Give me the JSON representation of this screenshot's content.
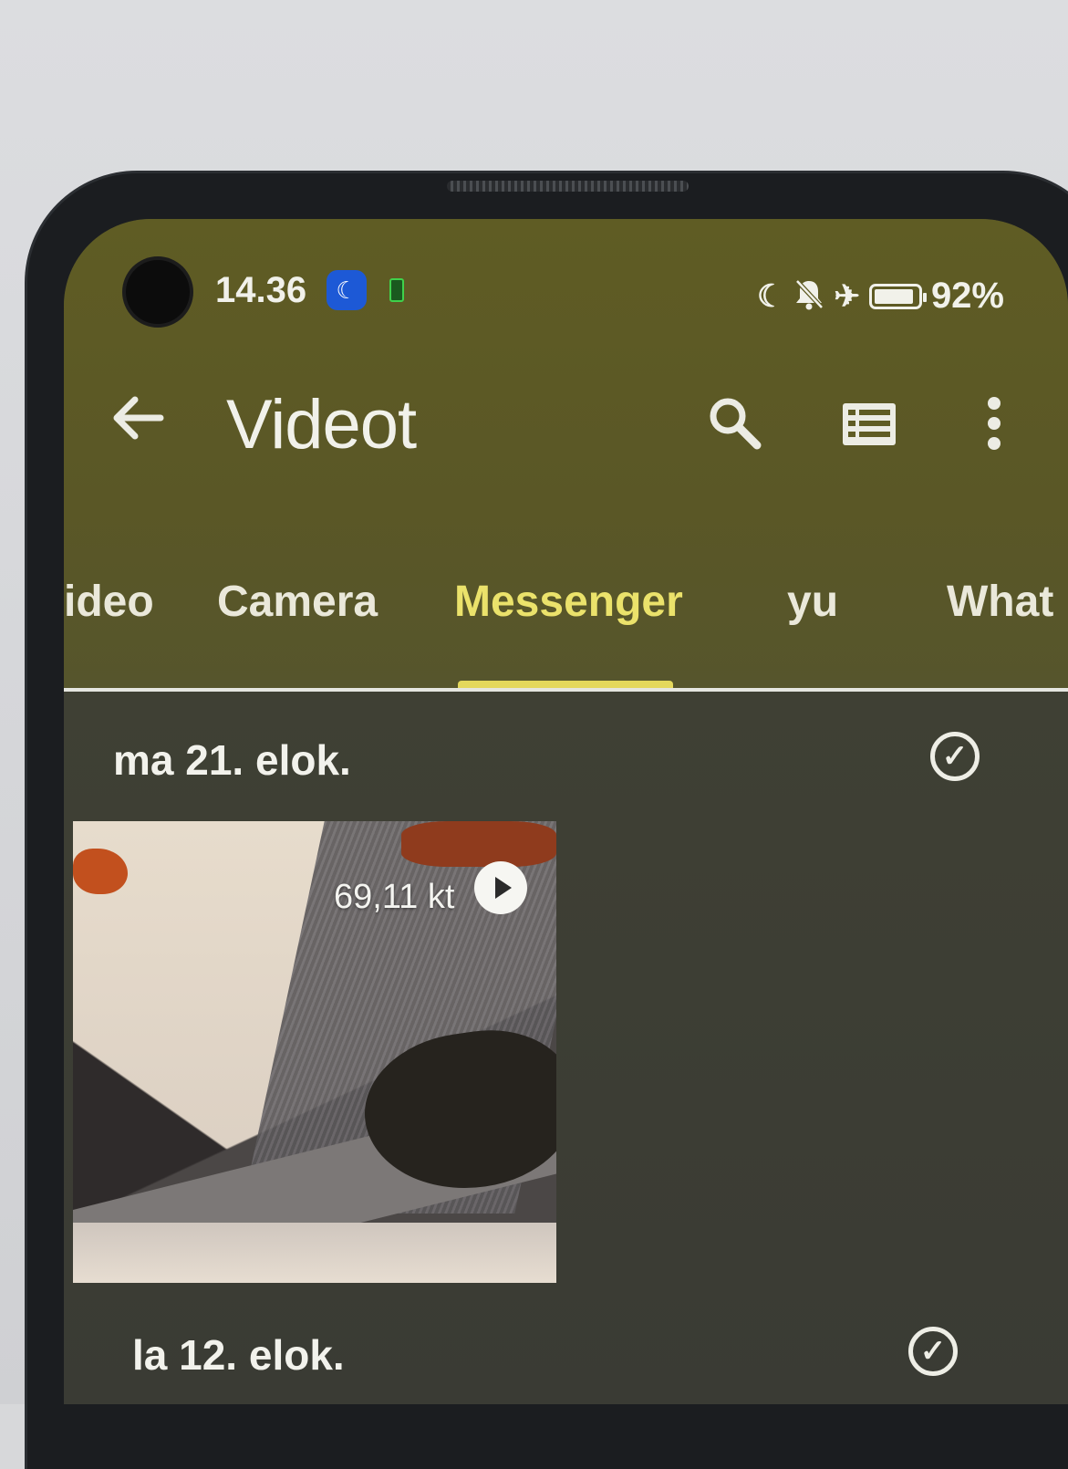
{
  "status_bar": {
    "time": "14.36",
    "battery_percent": "92%",
    "icons": [
      "dnd-moon-app-icon",
      "battery-saver-icon",
      "moon-icon",
      "bell-off-icon",
      "airplane-icon",
      "battery-icon"
    ]
  },
  "app_bar": {
    "title": "Videot",
    "back_icon": "arrow-left-icon",
    "actions": [
      "search-icon",
      "list-view-icon",
      "more-vert-icon"
    ]
  },
  "tabs": [
    {
      "label": "ideo",
      "active": false
    },
    {
      "label": "Camera",
      "active": false
    },
    {
      "label": "Messenger",
      "active": true
    },
    {
      "label": "yu",
      "active": false
    },
    {
      "label": "What",
      "active": false
    }
  ],
  "sections": [
    {
      "date": "ma 21. elok.",
      "videos": [
        {
          "size": "69,11 kt"
        }
      ]
    },
    {
      "date": "la 12. elok.",
      "videos": []
    }
  ],
  "colors": {
    "top_bar": "#5f5c24",
    "active_tab": "#ebe26b",
    "content_bg": "#3c3d31"
  }
}
